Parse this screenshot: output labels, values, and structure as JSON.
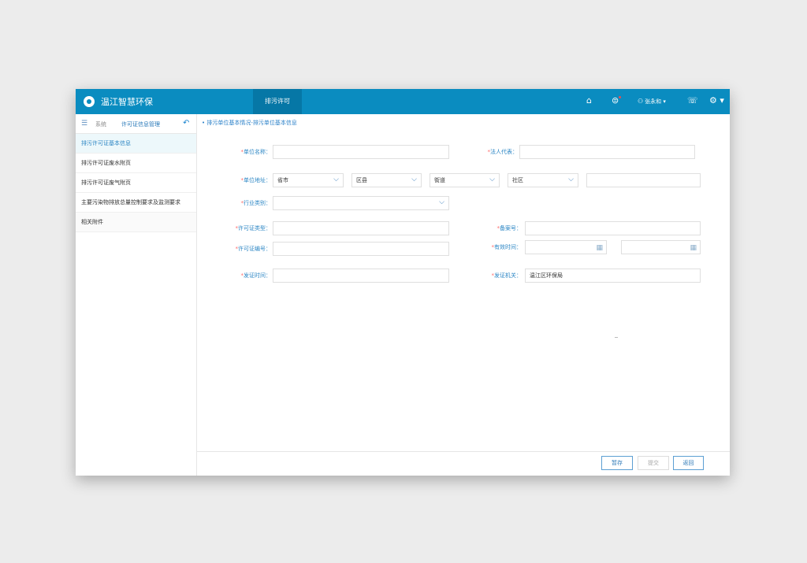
{
  "header": {
    "app_title": "温江智慧环保",
    "active_tab": "排污许可",
    "user_name": "张永和",
    "icons": [
      "home-icon",
      "message-icon",
      "user-icon",
      "phone-icon",
      "settings-icon"
    ]
  },
  "sidebar": {
    "system_label": "系统",
    "manage_label": "许可证信息管理",
    "items": [
      {
        "label": "排污许可证基本信息"
      },
      {
        "label": "排污许可证废水附页"
      },
      {
        "label": "排污许可证废气附页"
      },
      {
        "label": "主要污染物排放总量控制要求及监测要求"
      },
      {
        "label": "相关附件"
      }
    ]
  },
  "breadcrumb": "排污单位基本情况-排污单位基本信息",
  "form": {
    "labels": {
      "unit_name": "单位名称：",
      "legal_rep": "法人代表：",
      "unit_address": "单位地址：",
      "industry": "行业类别：",
      "permit_type": "许可证类型：",
      "record_no": "备案号：",
      "permit_no": "许可证编号：",
      "valid_time": "有效时间：",
      "issue_time": "发证时间：",
      "issuer": "发证机关："
    },
    "address": {
      "province": "省市",
      "district": "区县",
      "street": "街道",
      "community": "社区"
    },
    "issuer_value": "温江区环保局"
  },
  "buttons": {
    "save": "暂存",
    "submit": "提交",
    "back": "返回"
  }
}
